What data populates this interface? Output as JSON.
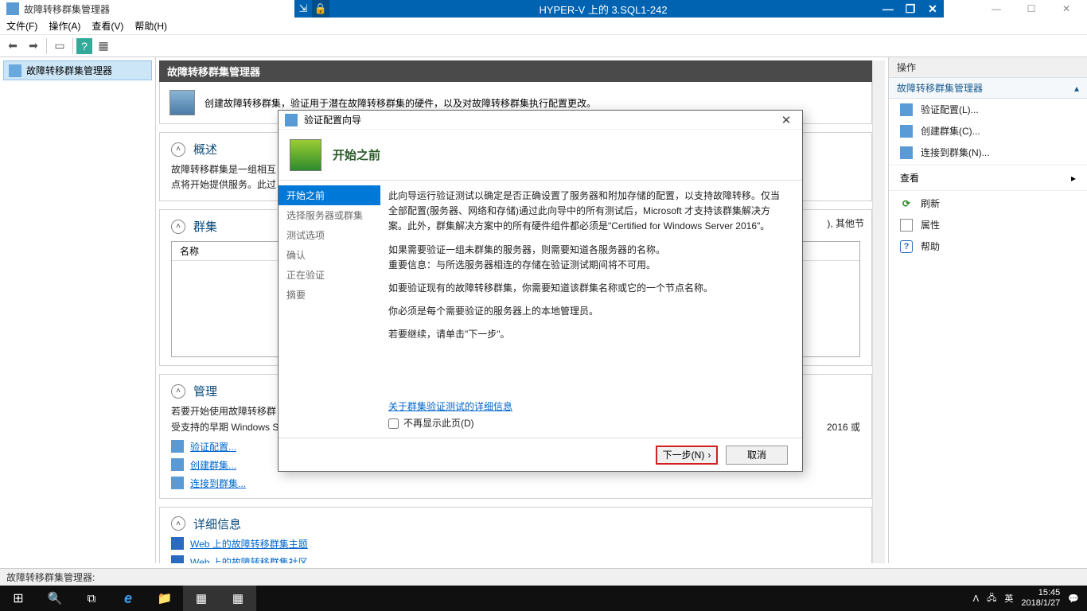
{
  "outer_window": {
    "min": "—",
    "max": "☐",
    "close": "✕"
  },
  "vm_titlebar": {
    "app_name": "故障转移群集管理器",
    "title": "HYPER-V 上的 3.SQL1-242",
    "min": "—",
    "max": "❐",
    "close": "✕",
    "pin": "⇲",
    "lock": "🔒"
  },
  "menubar": {
    "file": "文件(F)",
    "action": "操作(A)",
    "view": "查看(V)",
    "help": "帮助(H)"
  },
  "toolbar": {
    "back": "⬅",
    "fwd": "➡",
    "panes": "▭",
    "help": "?",
    "refresh": "▦"
  },
  "tree": {
    "root": "故障转移群集管理器"
  },
  "content": {
    "header": "故障转移群集管理器",
    "intro": "创建故障转移群集，验证用于潜在故障转移群集的硬件，以及对故障转移群集执行配置更改。",
    "overview_title": "概述",
    "overview_body1": "故障转移群集是一组相互",
    "overview_body2": "点将开始提供服务。此过",
    "clusters_title": "群集",
    "clusters_col": "名称",
    "manage_title": "管理",
    "manage_body1": "若要开始使用故障转移群",
    "manage_body2": "受支持的早期 Windows S",
    "manage_tail": "2016 或",
    "link_validate": "验证配置...",
    "link_create": "创建群集...",
    "link_connect": "连接到群集...",
    "details_title": "详细信息",
    "details_link1": "Web 上的故障转移群集主题",
    "details_link2": "Web 上的故障转移群集社区",
    "other_tail": "), 其他节"
  },
  "actions": {
    "title": "操作",
    "sub": "故障转移群集管理器",
    "validate": "验证配置(L)...",
    "create": "创建群集(C)...",
    "connect": "连接到群集(N)...",
    "view": "查看",
    "refresh": "刷新",
    "props": "属性",
    "help": "帮助"
  },
  "wizard": {
    "title": "验证配置向导",
    "banner": "开始之前",
    "steps": [
      "开始之前",
      "选择服务器或群集",
      "测试选项",
      "确认",
      "正在验证",
      "摘要"
    ],
    "p1": "此向导运行验证测试以确定是否正确设置了服务器和附加存储的配置，以支持故障转移。仅当全部配置(服务器、网络和存储)通过此向导中的所有测试后，Microsoft 才支持该群集解决方案。此外，群集解决方案中的所有硬件组件都必须是\"Certified for Windows Server 2016\"。",
    "p2a": "如果需要验证一组未群集的服务器，则需要知道各服务器的名称。",
    "p2b": "重要信息：与所选服务器相连的存储在验证测试期间将不可用。",
    "p3": "如要验证现有的故障转移群集，你需要知道该群集名称或它的一个节点名称。",
    "p4": "你必须是每个需要验证的服务器上的本地管理员。",
    "p5": "若要继续，请单击\"下一步\"。",
    "more_link": "关于群集验证测试的详细信息",
    "dont_show": "不再显示此页(D)",
    "next": "下一步(N)",
    "cancel": "取消"
  },
  "statusbar": {
    "text": "故障转移群集管理器:"
  },
  "taskbar": {
    "start": "⊞",
    "search": "🔍",
    "taskview": "⧉",
    "ie": "e",
    "explorer": "📁",
    "fcm": "▦",
    "fcm2": "▦",
    "tray_up": "ᐱ",
    "net": "🖧",
    "ime": "英",
    "time": "15:45",
    "date": "2018/1/27",
    "notif": "💬"
  }
}
